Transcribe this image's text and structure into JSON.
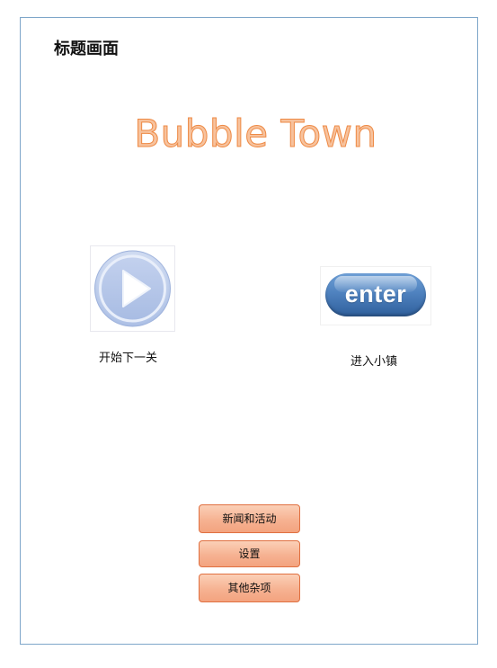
{
  "page": {
    "title": "标题画面"
  },
  "logo": {
    "text": "Bubble Town",
    "fill_color": "#f7c29d",
    "outline_color": "#ee8a45"
  },
  "actions": {
    "play": {
      "icon": "play-icon",
      "caption": "开始下一关"
    },
    "enter": {
      "icon": "enter-button-image",
      "label": "enter",
      "caption": "进入小镇"
    }
  },
  "menu": {
    "buttons": [
      {
        "label": "新闻和活动"
      },
      {
        "label": "设置"
      },
      {
        "label": "其他杂项"
      }
    ],
    "button_color": "#f6b292",
    "button_border_color": "#e07040"
  }
}
